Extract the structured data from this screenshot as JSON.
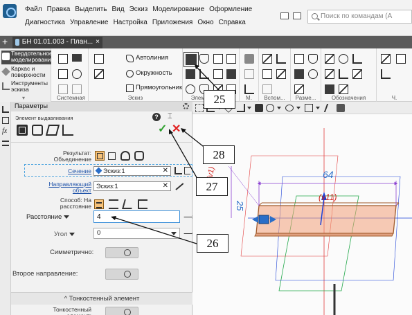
{
  "menu": {
    "row1": [
      "Файл",
      "Правка",
      "Выделить",
      "Вид",
      "Эскиз",
      "Моделирование",
      "Оформление"
    ],
    "row2": [
      "Диагностика",
      "Управление",
      "Настройка",
      "Приложения",
      "Окно",
      "Справка"
    ]
  },
  "search": {
    "placeholder": "Поиск по командам (А"
  },
  "document_tab": {
    "label": "БН 01.01.003 - План..."
  },
  "toolbar": {
    "categories": [
      "Твердотельное моделирование",
      "Каркас и поверхности",
      "Инструменты эскиза"
    ],
    "sketch_buttons": [
      "Автолиния",
      "Окружность",
      "Прямоугольник"
    ],
    "group_labels": [
      "Системная",
      "Эскиз",
      "Элементы тела",
      "М.",
      "Вспом...",
      "Разме...",
      "Обозначения",
      "Ч."
    ]
  },
  "panel": {
    "title": "Параметры",
    "subtitle": "Элемент выдавливания",
    "result_label": "Результат: Объединение",
    "section_label": "Сечение",
    "section_value": "Эскиз:1",
    "direction_label": "Направляющий объект",
    "direction_value": "Эскиз:1",
    "method_label": "Способ: На расстояние",
    "distance_label": "Расстояние",
    "distance_value": "4",
    "angle_label": "Угол",
    "angle_value": "0",
    "symmetric_label": "Симметрично:",
    "second_direction_label": "Второе направление:",
    "thin_header": "^ Тонкостенный элемент",
    "thin_label": "Тонкостенный элемент:"
  },
  "drawing": {
    "width_dimension": "64",
    "height_dimension": "25",
    "variable_label": "(v11)",
    "side_label": "(v1)"
  },
  "callouts": [
    "25",
    "28",
    "27",
    "26"
  ],
  "colors": {
    "accent": "#3a8fd9",
    "confirm": "#2da02d",
    "cancel": "#e02020",
    "model_face": "#f2a07a",
    "dimension": "#8a3fd1",
    "variable": "#d0231c",
    "axis_blue": "#1a3fd6",
    "axis_green": "#22a84a",
    "axis_red": "#e23b3b"
  }
}
